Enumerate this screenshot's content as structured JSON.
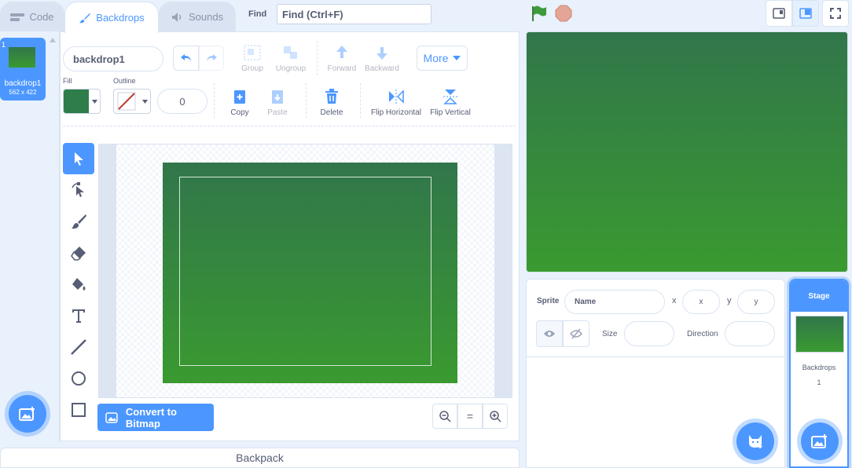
{
  "tabs": [
    {
      "label": "Code"
    },
    {
      "label": "Backdrops"
    },
    {
      "label": "Sounds"
    }
  ],
  "find": {
    "label": "Find",
    "placeholder": "Find (Ctrl+F)"
  },
  "backdrop_list": {
    "items": [
      {
        "index": "1",
        "name": "backdrop1",
        "size": "562 x 422"
      }
    ]
  },
  "editor": {
    "costume_name": "backdrop1",
    "fill_label": "Fill",
    "outline_label": "Outline",
    "outline_width": "0",
    "fill_color": "#2e7d4a",
    "buttons": {
      "group": "Group",
      "ungroup": "Ungroup",
      "forward": "Forward",
      "backward": "Backward",
      "more": "More",
      "copy": "Copy",
      "paste": "Paste",
      "delete": "Delete",
      "flip_horizontal": "Flip Horizontal",
      "flip_vertical": "Flip Vertical"
    },
    "convert_label": "Convert to Bitmap",
    "zoom_reset": "="
  },
  "backpack": {
    "label": "Backpack"
  },
  "sprite_info": {
    "sprite_label": "Sprite",
    "name_placeholder": "Name",
    "x_label": "x",
    "x_placeholder": "x",
    "y_label": "y",
    "y_placeholder": "y",
    "size_label": "Size",
    "direction_label": "Direction"
  },
  "stage_pane": {
    "title": "Stage",
    "backdrops_label": "Backdrops",
    "backdrops_count": "1"
  },
  "colors": {
    "accent": "#4c97ff",
    "gradient_top": "#31764b",
    "gradient_bottom": "#3a9a30",
    "flag": "#3d9a3d",
    "stop": "#e4a596"
  }
}
